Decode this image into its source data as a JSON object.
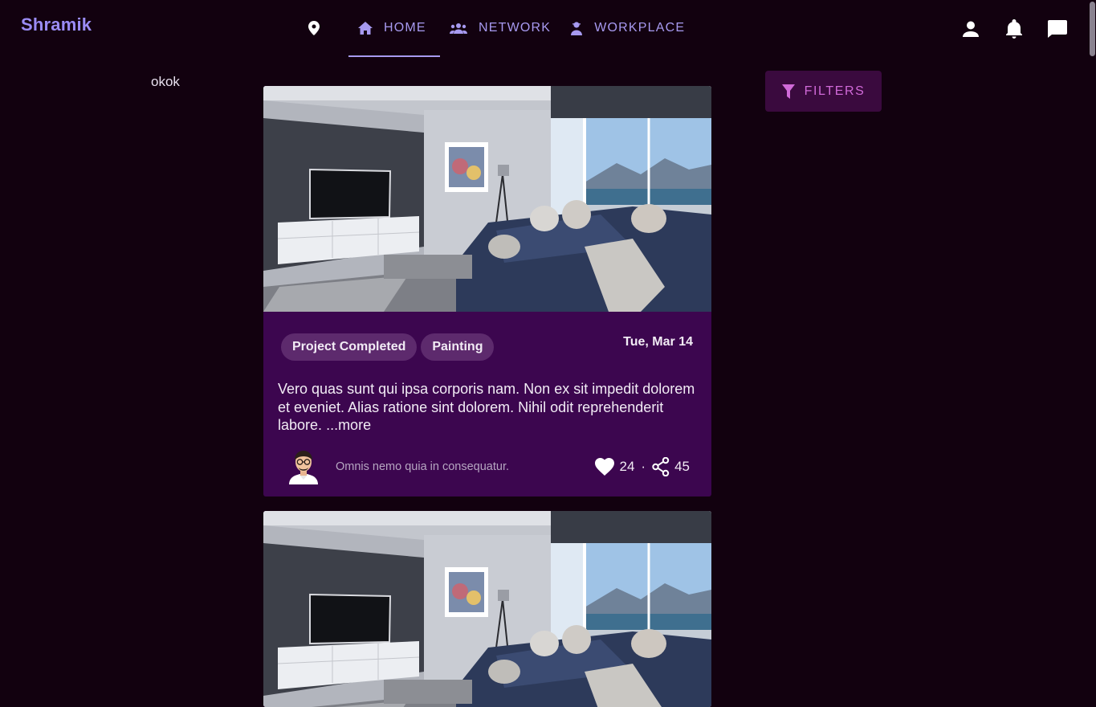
{
  "app": {
    "brand": "Shramik"
  },
  "nav": {
    "location_icon": "location-pin-icon",
    "tabs": [
      {
        "label": "HOME",
        "icon": "home-icon",
        "active": true
      },
      {
        "label": "NETWORK",
        "icon": "people-icon",
        "active": false
      },
      {
        "label": "WORKPLACE",
        "icon": "worker-icon",
        "active": false
      }
    ]
  },
  "header_actions": [
    {
      "icon": "person-icon"
    },
    {
      "icon": "bell-icon"
    },
    {
      "icon": "chat-icon"
    }
  ],
  "sidebar_text": "okok",
  "filters": {
    "label": "FILTERS",
    "icon": "filter-icon"
  },
  "posts": [
    {
      "image": "living-room-photo",
      "tags": [
        "Project Completed",
        "Painting"
      ],
      "date": "Tue, Mar 14",
      "description": "Vero quas sunt qui ipsa corporis nam. Non ex sit impedit dolorem et eveniet. Alias ratione sint dolorem. Nihil odit reprehenderit labore.",
      "more_label": "...more",
      "author": "Omnis nemo quia in consequatur.",
      "likes": "24",
      "shares": "45",
      "separator": "·"
    },
    {
      "image": "living-room-photo"
    }
  ],
  "colors": {
    "background": "#12010f",
    "card": "#3c064f",
    "accent": "#a79af0",
    "filter_text": "#d06ad8"
  }
}
